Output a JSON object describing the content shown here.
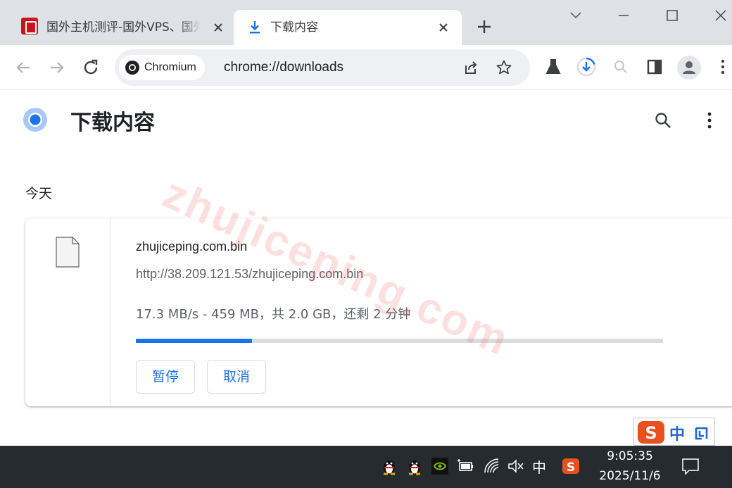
{
  "tabs": [
    {
      "title": "国外主机测评-国外VPS、国外",
      "active": false
    },
    {
      "title": "下载内容",
      "active": true
    }
  ],
  "toolbar": {
    "chip_label": "Chromium",
    "url": "chrome://downloads"
  },
  "page": {
    "title": "下载内容",
    "section_date": "今天"
  },
  "download": {
    "file_name": "zhujiceping.com.bin",
    "url": "http://38.209.121.53/zhujiceping.com.bin",
    "status": "17.3 MB/s - 459 MB，共 2.0 GB，还剩 2 分钟",
    "progress": 0.22,
    "pause_label": "暂停",
    "cancel_label": "取消"
  },
  "watermark": "zhujiceping.com",
  "ime": {
    "mode": "中"
  },
  "taskbar": {
    "ime_indicator": "中",
    "time": "9:05:35",
    "date": "2025/11/6"
  },
  "colors": {
    "accent": "#1a73e8",
    "tab_strip": "#dee1e6",
    "taskbar": "#262b30"
  }
}
